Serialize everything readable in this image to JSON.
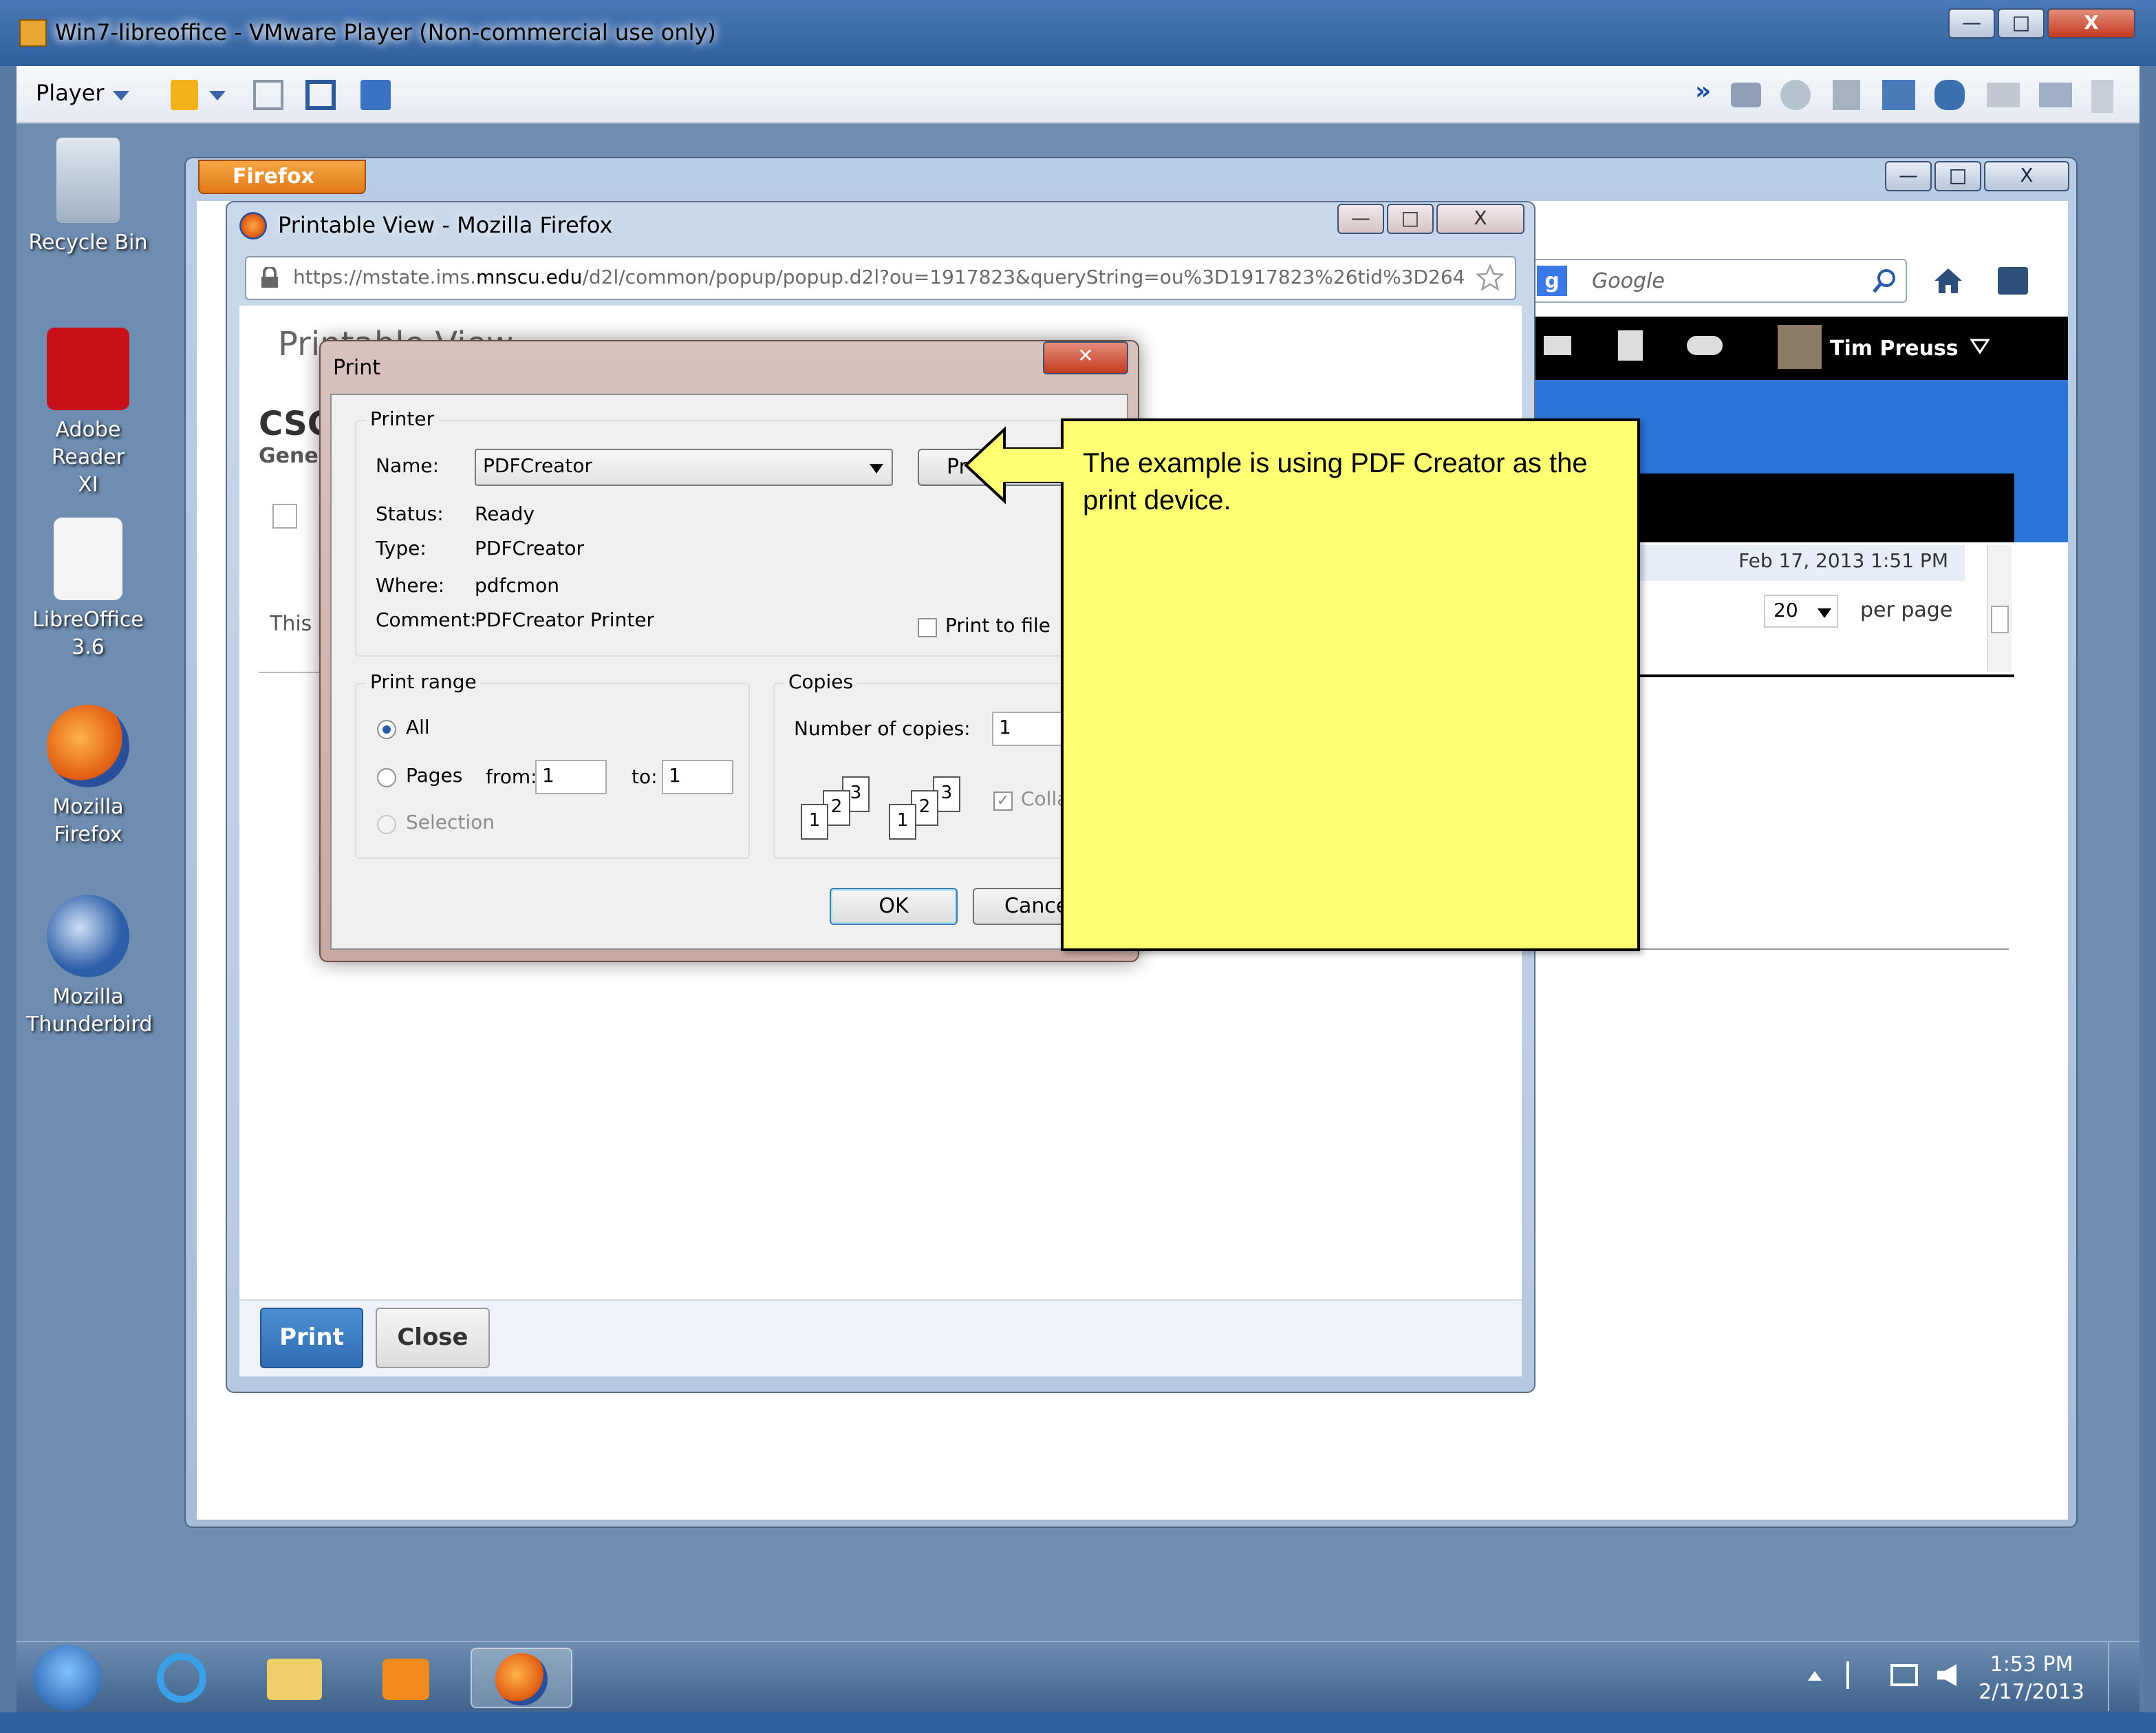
{
  "vm": {
    "title": "Win7-libreoffice - VMware Player (Non-commercial use only)",
    "player_menu": "Player",
    "window_controls": {
      "minimize": "—",
      "maximize": "□",
      "close": "X"
    }
  },
  "desktop": {
    "icons": [
      {
        "label": "Recycle Bin",
        "icon": "recycle-bin-icon"
      },
      {
        "label": "Adobe Reader XI",
        "icon": "adobe-reader-icon"
      },
      {
        "label": "LibreOffice 3.6",
        "icon": "libreoffice-icon"
      },
      {
        "label": "Mozilla Firefox",
        "icon": "firefox-icon"
      },
      {
        "label": "Mozilla Thunderbird",
        "icon": "thunderbird-icon"
      }
    ]
  },
  "firefox": {
    "menu_button": "Firefox",
    "search_placeholder": "Google",
    "user_name": "Tim Preuss",
    "date_text": "Feb 17, 2013 1:51 PM",
    "per_page_value": "20",
    "per_page_label": "per page"
  },
  "printable_view": {
    "window_title": "Printable View - Mozilla Firefox",
    "url_prefix": "https://mstate.ims.",
    "url_domain": "mnscu.edu",
    "url_rest": "/d2l/common/popup/popup.d2l?ou=1917823&queryString=ou%3D1917823%26tid%3D264",
    "page_heading": "Printable View",
    "course_code": "CSC",
    "sub_heading": "Gene",
    "body_text": "This",
    "print_button": "Print",
    "close_button": "Close"
  },
  "print_dialog": {
    "title": "Print",
    "printer_group": "Printer",
    "name_label": "Name:",
    "name_value": "PDFCreator",
    "properties_button": "Pr",
    "status_label": "Status:",
    "status_value": "Ready",
    "type_label": "Type:",
    "type_value": "PDFCreator",
    "where_label": "Where:",
    "where_value": "pdfcmon",
    "comment_label": "Comment:",
    "comment_value": "PDFCreator Printer",
    "print_to_file": "Print to file",
    "range_group": "Print range",
    "range_all": "All",
    "range_pages": "Pages",
    "from_label": "from:",
    "from_value": "1",
    "to_label": "to:",
    "to_value": "1",
    "range_selection": "Selection",
    "copies_group": "Copies",
    "copies_label": "Number of copies:",
    "copies_value": "1",
    "collate_label": "Colla",
    "ok_button": "OK",
    "cancel_button": "Cance",
    "collate_pages": [
      "1",
      "2",
      "3"
    ]
  },
  "callout": {
    "text": "The example is using PDF Creator as the print device."
  },
  "taskbar": {
    "time": "1:53 PM",
    "date": "2/17/2013"
  },
  "colors": {
    "callout_bg": "#ffff73",
    "print_button_bg": "#2f6cb4",
    "d2l_blue": "#2a75d7",
    "firefox_orange": "#e0791a"
  }
}
